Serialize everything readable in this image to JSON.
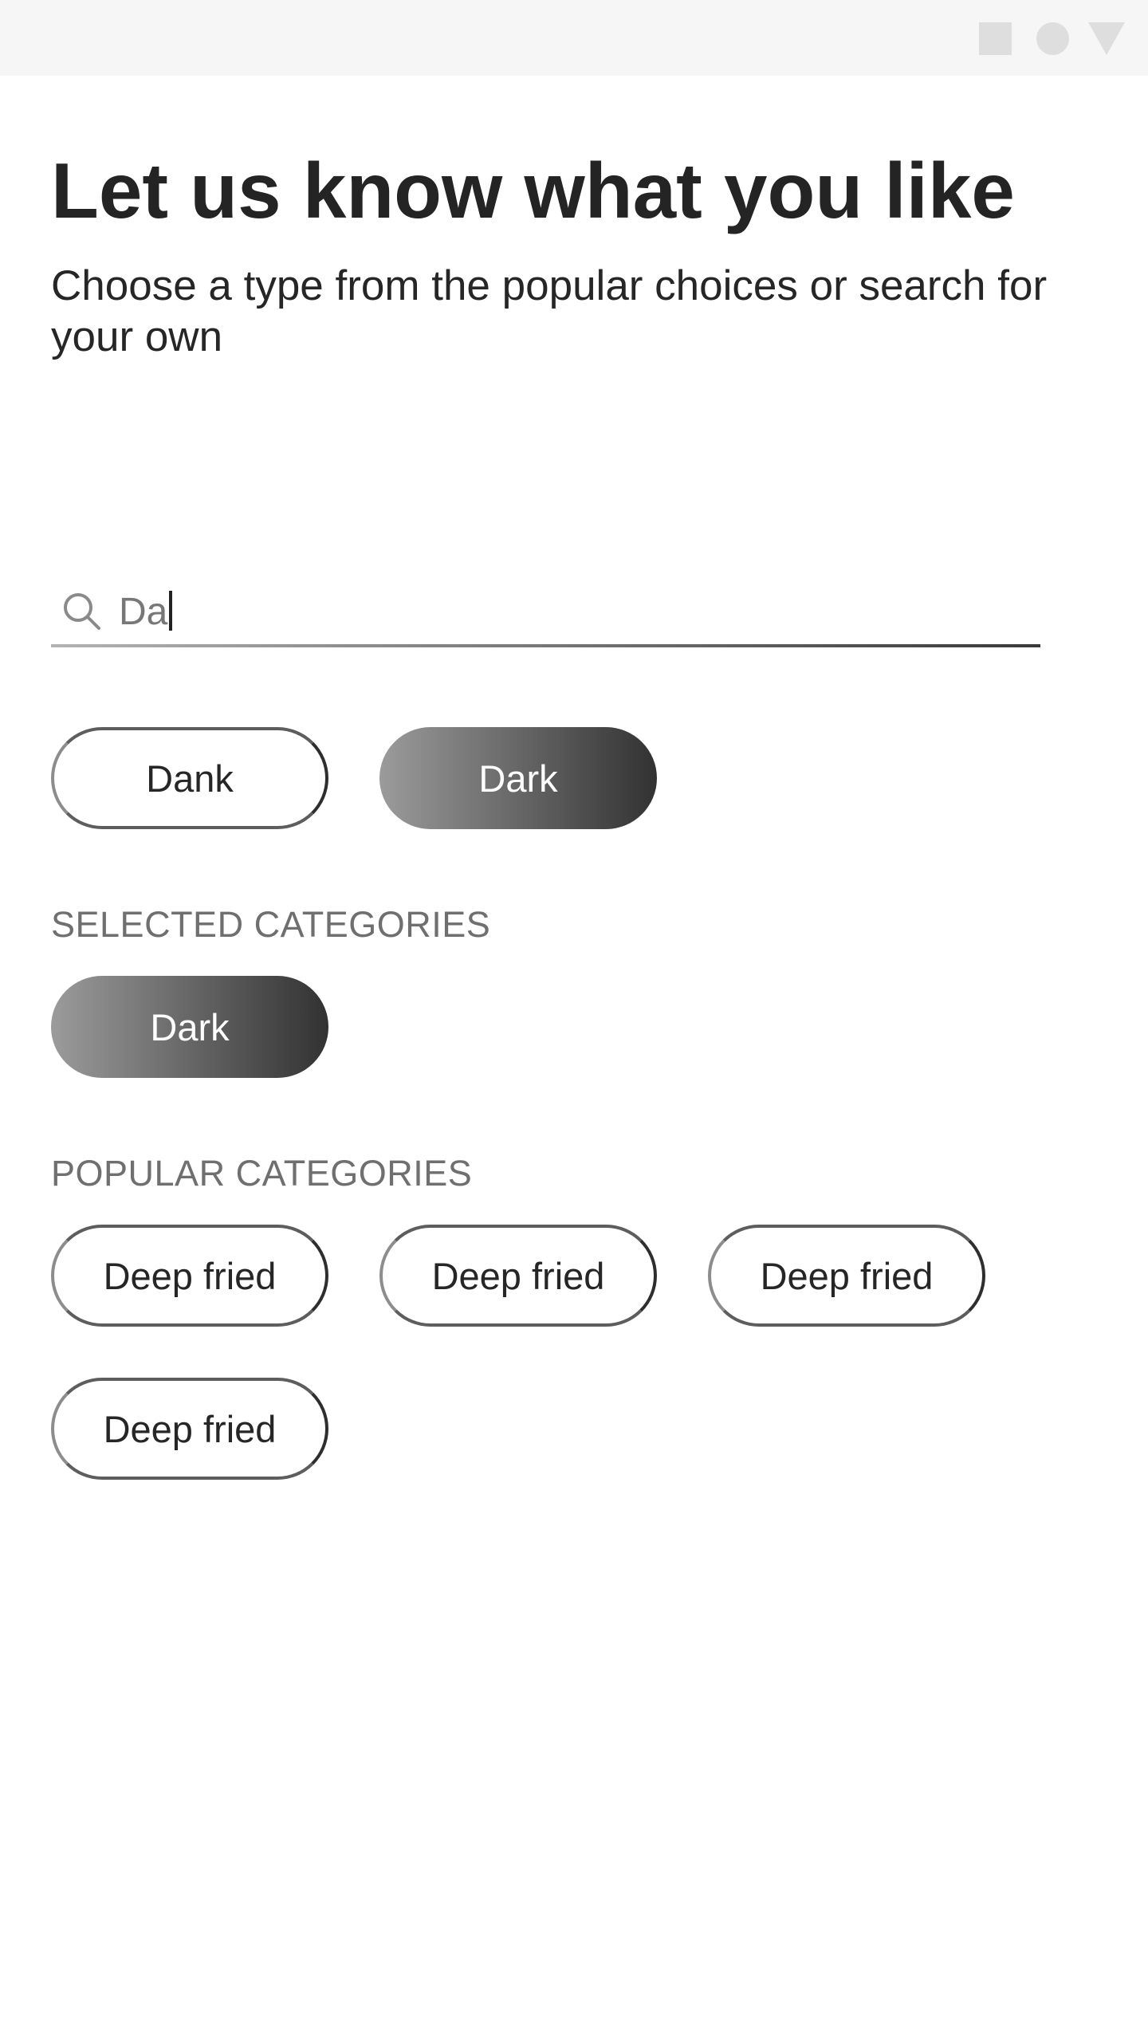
{
  "status_bar": {
    "icons": [
      "square-icon",
      "circle-icon",
      "triangle-icon"
    ],
    "color": "#dedede"
  },
  "header": {
    "title": "Let us know what you like",
    "subtitle": "Choose a type from the popular choices or search for your own"
  },
  "search": {
    "icon": "search-icon",
    "value": "Da",
    "placeholder": ""
  },
  "suggestions": [
    {
      "label": "Dank",
      "selected": false
    },
    {
      "label": "Dark",
      "selected": true
    }
  ],
  "selected_categories": {
    "heading": "SELECTED CATEGORIES",
    "items": [
      {
        "label": "Dark"
      }
    ]
  },
  "popular_categories": {
    "heading": "POPULAR CATEGORIES",
    "items": [
      {
        "label": "Deep fried"
      },
      {
        "label": "Deep fried"
      },
      {
        "label": "Deep fried"
      },
      {
        "label": "Deep fried"
      }
    ]
  },
  "colors": {
    "chip_gradient_start": "#9b9b9b",
    "chip_gradient_end": "#323232",
    "chip_border": "#5d5d5d",
    "section_label": "#6f6f6f"
  }
}
